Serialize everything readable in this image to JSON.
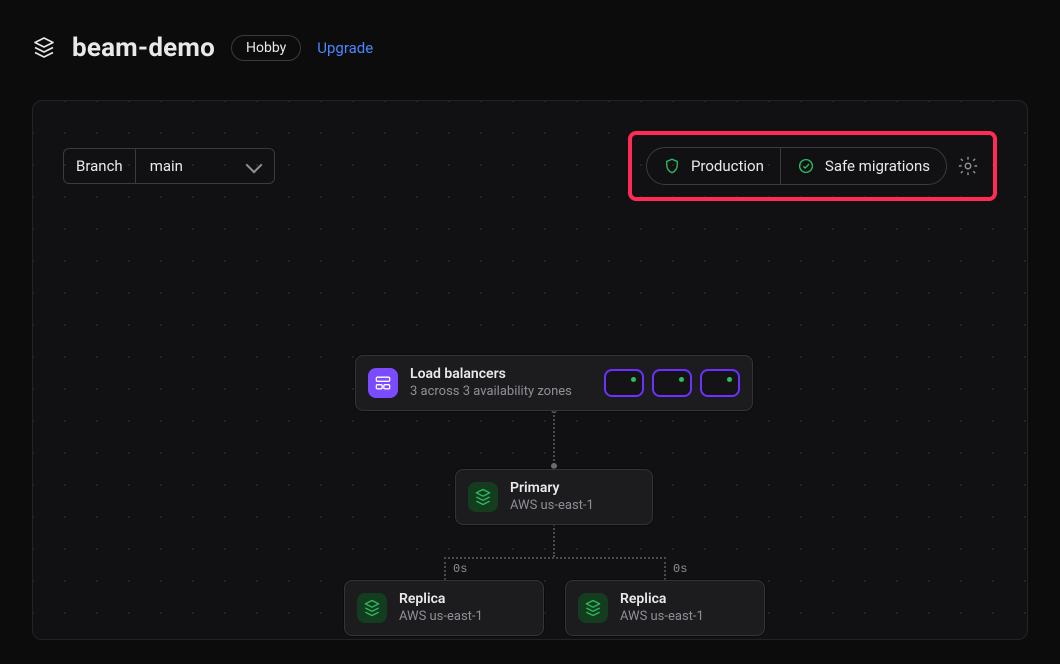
{
  "header": {
    "project_name": "beam-demo",
    "plan_badge": "Hobby",
    "upgrade_label": "Upgrade"
  },
  "dashboard": {
    "branch_label": "Branch",
    "branch_value": "main",
    "status": {
      "production_label": "Production",
      "safe_migrations_label": "Safe migrations"
    }
  },
  "nodes": {
    "load_balancers": {
      "title": "Load balancers",
      "subtitle": "3 across 3 availability zones"
    },
    "primary": {
      "title": "Primary",
      "subtitle": "AWS us-east-1"
    },
    "replica1": {
      "title": "Replica",
      "subtitle": "AWS us-east-1",
      "latency": "0s"
    },
    "replica2": {
      "title": "Replica",
      "subtitle": "AWS us-east-1",
      "latency": "0s"
    }
  }
}
